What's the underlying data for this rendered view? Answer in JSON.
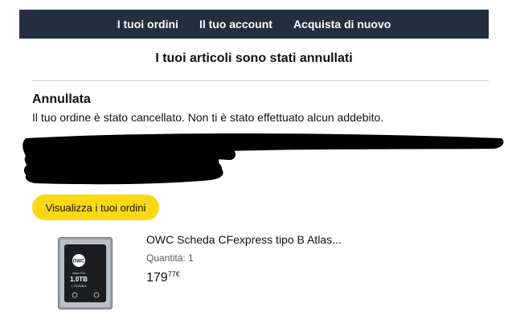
{
  "nav": {
    "orders": "I tuoi ordini",
    "account": "Il tuo account",
    "buy_again": "Acquista di nuovo"
  },
  "headline": "I tuoi articoli sono stati annullati",
  "status": {
    "title": "Annullata",
    "description": "Il tuo ordine è stato cancellato. Non ti è stato effettuato alcun addebito."
  },
  "view_orders_button": "Visualizza i tuoi ordini",
  "product": {
    "title": "OWC Scheda CFexpress tipo B Atlas...",
    "quantity_label": "Quantità:",
    "quantity": "1",
    "price_whole": "179",
    "price_cents": "77€",
    "card_brand": "OWC",
    "card_series": "Atlas Pro",
    "card_capacity": "1.0TB",
    "card_speed": "1,700MB/s"
  },
  "colors": {
    "nav_bg": "#232f3e",
    "button_bg": "#ffd814",
    "redaction": "#000000"
  }
}
